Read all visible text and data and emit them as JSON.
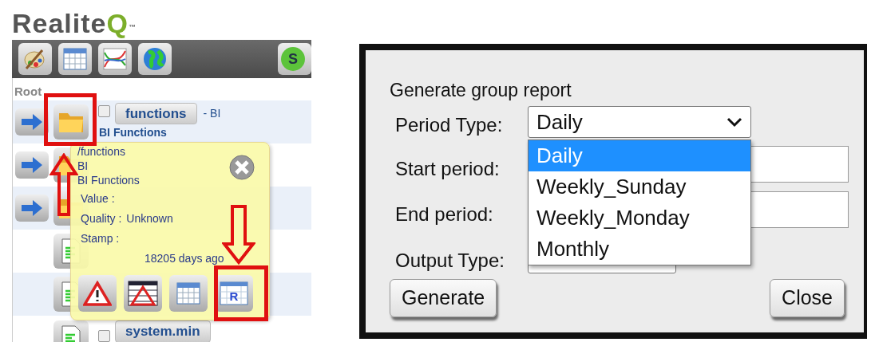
{
  "logo": {
    "text": "RealiteQ",
    "trademark": "™"
  },
  "toolbar": {
    "buttons": [
      {
        "kind": "palette"
      },
      {
        "kind": "table"
      },
      {
        "kind": "chart"
      },
      {
        "kind": "globe"
      },
      {
        "kind": "partial",
        "label": "S"
      }
    ]
  },
  "breadcrumb": [
    "Root"
  ],
  "tree": {
    "rows": [
      {
        "kind": "group",
        "checked": false,
        "name": "functions",
        "suffix": "- BI",
        "description": "BI Functions"
      },
      {
        "kind": "group"
      },
      {
        "kind": "group"
      },
      {
        "kind": "item"
      },
      {
        "kind": "item"
      },
      {
        "kind": "item",
        "checked": false,
        "name": "system.min"
      }
    ]
  },
  "popup": {
    "path": "/functions",
    "group": "BI",
    "description": "BI Functions",
    "fields": [
      {
        "label": "Value :"
      },
      {
        "label": "Quality :",
        "value": "Unknown"
      },
      {
        "label": "Stamp :"
      }
    ],
    "age": "18205 days ago",
    "buttons": [
      {
        "kind": "alarm"
      },
      {
        "kind": "alarm-table"
      },
      {
        "kind": "table"
      },
      {
        "kind": "report",
        "label": "R"
      }
    ]
  },
  "dialog": {
    "title": "Generate group report",
    "fields": [
      {
        "kind": "select",
        "label": "Period Type:",
        "value": "Daily",
        "expanded": true,
        "options": [
          {
            "label": "Daily",
            "selected": true
          },
          {
            "label": "Weekly_Sunday",
            "selected": false
          },
          {
            "label": "Weekly_Monday",
            "selected": false
          },
          {
            "label": "Monthly",
            "selected": false
          }
        ]
      },
      {
        "kind": "text",
        "label": "Start period:"
      },
      {
        "kind": "text",
        "label": "End period:"
      },
      {
        "kind": "select",
        "label": "Output Type:"
      }
    ],
    "buttons": [
      {
        "label": "Generate",
        "kind": "primary"
      },
      {
        "label": "Close",
        "kind": "secondary"
      }
    ]
  }
}
